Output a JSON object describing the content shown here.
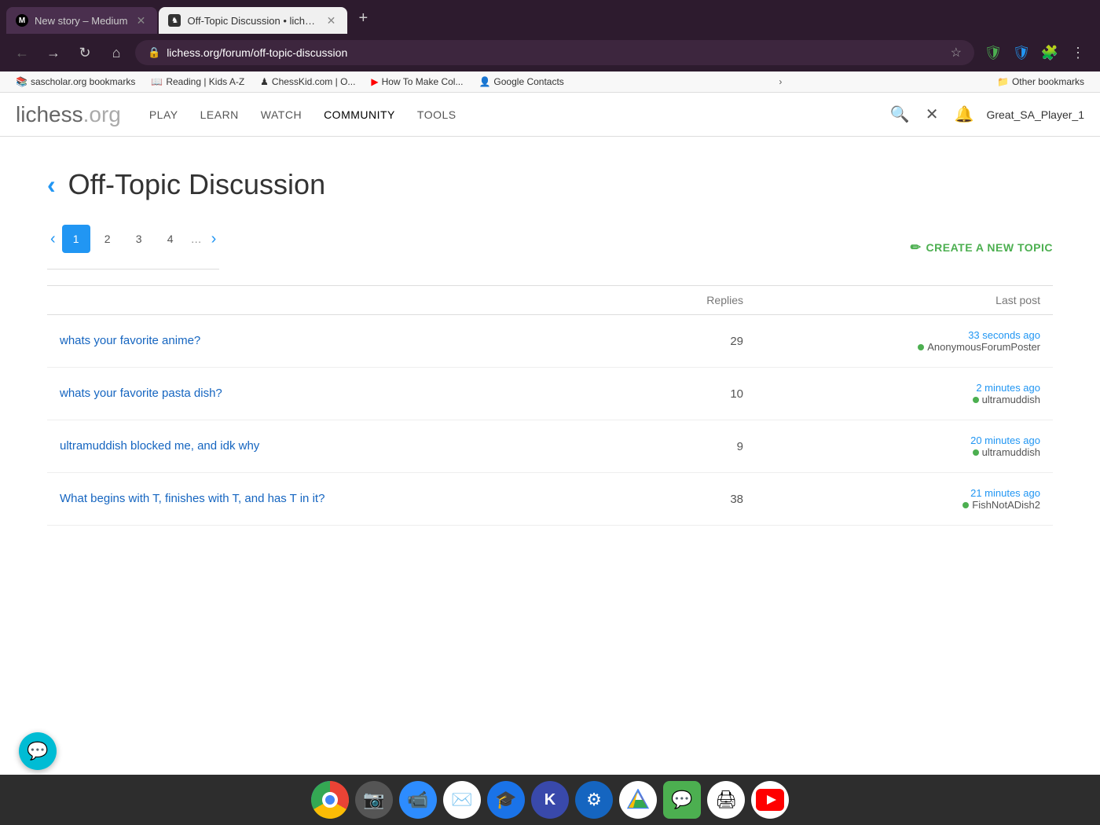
{
  "browser": {
    "tabs": [
      {
        "id": "tab1",
        "title": "New story – Medium",
        "favicon_type": "medium",
        "active": false,
        "url": ""
      },
      {
        "id": "tab2",
        "title": "Off-Topic Discussion • lichess...",
        "favicon_type": "lichess",
        "active": true,
        "url": "lichess.org/forum/off-topic-discussion"
      }
    ],
    "new_tab_label": "+",
    "address": "lichess.org/forum/off-topic-discussion",
    "bookmarks": [
      {
        "label": "sascholar.org bookmarks",
        "icon": "📚"
      },
      {
        "label": "Reading | Kids A-Z",
        "icon": "📖"
      },
      {
        "label": "ChessKid.com | O...",
        "icon": "♟"
      },
      {
        "label": "How To Make Col...",
        "icon": "▶"
      },
      {
        "label": "Google Contacts",
        "icon": "👤"
      }
    ],
    "bookmarks_other_label": "Other bookmarks",
    "more_label": "›"
  },
  "lichess": {
    "logo_main": "lichess",
    "logo_ext": ".org",
    "nav": [
      {
        "label": "PLAY",
        "key": "play"
      },
      {
        "label": "LEARN",
        "key": "learn"
      },
      {
        "label": "WATCH",
        "key": "watch"
      },
      {
        "label": "COMMUNITY",
        "key": "community",
        "active": true
      },
      {
        "label": "TOOLS",
        "key": "tools"
      }
    ],
    "username": "Great_SA_Player_1"
  },
  "page": {
    "back_label": "‹",
    "title": "Off-Topic Discussion",
    "pagination": {
      "prev_label": "‹",
      "pages": [
        "1",
        "2",
        "3",
        "4"
      ],
      "dots": "…",
      "next_label": "›",
      "active_page": "1"
    },
    "create_topic_label": "CREATE A NEW TOPIC",
    "table_headers": {
      "topic": "",
      "replies": "Replies",
      "last_post": "Last post"
    },
    "topics": [
      {
        "title": "whats your favorite anime?",
        "replies": 29,
        "last_post_time": "33 seconds ago",
        "last_post_user": "AnonymousForumPoster",
        "user_online": true
      },
      {
        "title": "whats your favorite pasta dish?",
        "replies": 10,
        "last_post_time": "2 minutes ago",
        "last_post_user": "ultramuddish",
        "user_online": true
      },
      {
        "title": "ultramuddish blocked me, and idk why",
        "replies": 9,
        "last_post_time": "20 minutes ago",
        "last_post_user": "ultramuddish",
        "user_online": true
      },
      {
        "title": "What begins with T, finishes with T, and has T in it?",
        "replies": 38,
        "last_post_time": "21 minutes ago",
        "last_post_user": "FishNotADish2",
        "user_online": true
      }
    ]
  },
  "taskbar": {
    "icons": [
      {
        "name": "chrome",
        "emoji": "🌐",
        "bg": "#fff"
      },
      {
        "name": "camera",
        "emoji": "📷",
        "bg": "#555"
      },
      {
        "name": "zoom",
        "emoji": "📹",
        "bg": "#2D8CFF"
      },
      {
        "name": "gmail",
        "emoji": "✉",
        "bg": "#fff"
      },
      {
        "name": "classroom",
        "emoji": "🎓",
        "bg": "#1a73e8"
      },
      {
        "name": "klokki",
        "emoji": "K",
        "bg": "#3949AB"
      },
      {
        "name": "settings",
        "emoji": "⚙",
        "bg": "#1565C0"
      },
      {
        "name": "drive",
        "emoji": "▲",
        "bg": "#fff"
      },
      {
        "name": "android-messages",
        "emoji": "💬",
        "bg": "#4CAF50"
      },
      {
        "name": "printer",
        "emoji": "🖨",
        "bg": "#fff"
      },
      {
        "name": "youtube",
        "emoji": "▶",
        "bg": "#fff"
      }
    ]
  }
}
